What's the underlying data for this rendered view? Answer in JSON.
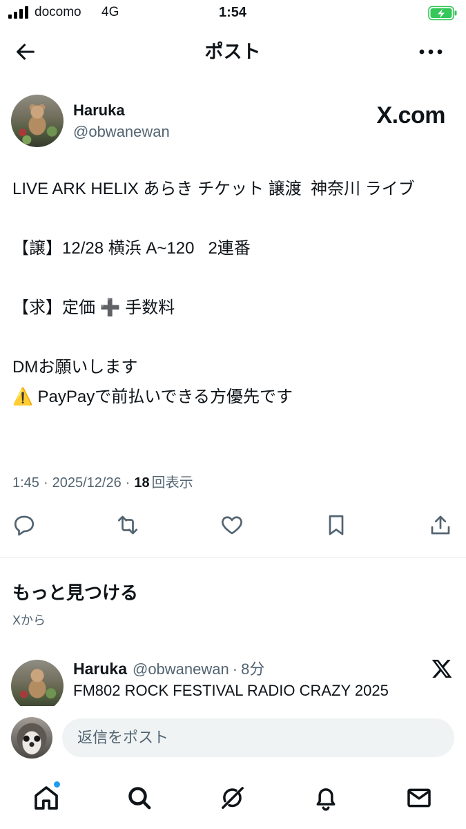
{
  "status_bar": {
    "carrier": "docomo",
    "network": "4G",
    "time": "1:54",
    "signal_icon": "signal-bars-icon",
    "battery_icon": "battery-charging-icon"
  },
  "header": {
    "title": "ポスト",
    "back_icon": "back-arrow-icon",
    "more_icon": "more-icon"
  },
  "post": {
    "author": {
      "name": "Haruka",
      "handle": "@obwanewan"
    },
    "brand_label": "X.com",
    "body": [
      "LIVE ARK HELIX あらき チケット 譲渡  神奈川 ライブ",
      "【譲】12/28 横浜 A~120   2連番",
      "【求】定価 ➕ 手数料",
      "DMお願いします",
      "⚠️ PayPayで前払いできる方優先です"
    ],
    "meta": {
      "time": "1:45",
      "separator": "·",
      "date": "2025/12/26",
      "views_count": "18",
      "views_label": "回表示"
    },
    "actions": [
      {
        "icon": "reply-icon"
      },
      {
        "icon": "repost-icon"
      },
      {
        "icon": "like-icon"
      },
      {
        "icon": "bookmark-icon"
      },
      {
        "icon": "share-icon"
      }
    ]
  },
  "discover": {
    "title": "もっと見つける",
    "source": "Xから"
  },
  "recommended_post": {
    "author": {
      "name": "Haruka",
      "handle": "@obwanewan"
    },
    "separator": "·",
    "time": "8分",
    "text": "FM802 ROCK FESTIVAL RADIO CRAZY 2025",
    "logo_icon": "x-logo-icon"
  },
  "reply_composer": {
    "placeholder": "返信をポスト"
  },
  "bottom_nav": {
    "items": [
      {
        "icon": "home-icon",
        "active": true,
        "has_badge": true
      },
      {
        "icon": "search-icon"
      },
      {
        "icon": "grok-icon"
      },
      {
        "icon": "bell-icon"
      },
      {
        "icon": "mail-icon"
      }
    ]
  },
  "colors": {
    "text": "#0F1419",
    "secondary": "#536471",
    "accent": "#1D9BF0",
    "battery": "#34C759",
    "input": "#EFF3F4"
  }
}
